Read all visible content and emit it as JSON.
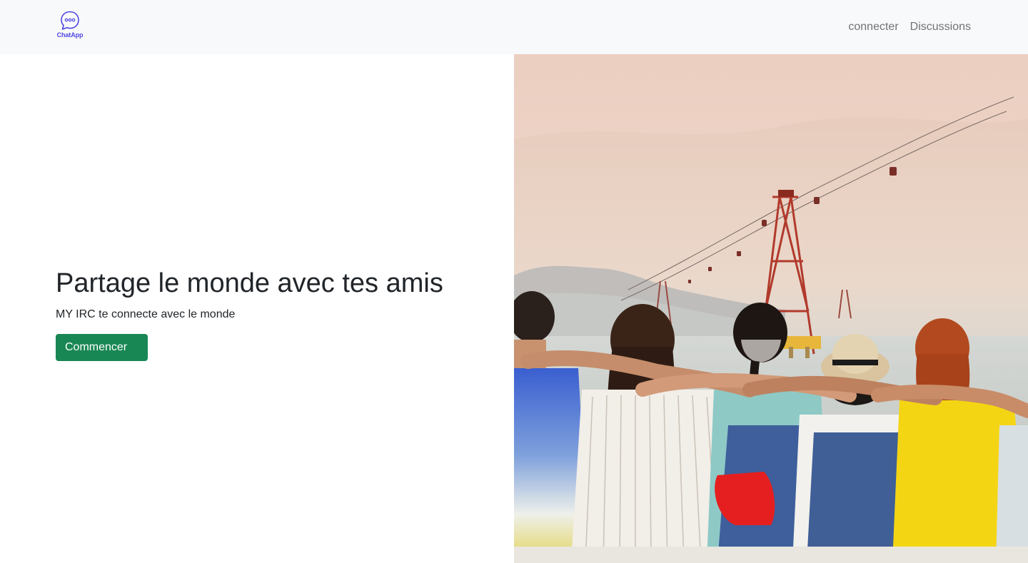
{
  "navbar": {
    "brand": {
      "icon": "chat-bubble-icon",
      "label": "ChatApp",
      "color": "#4f46e5"
    },
    "links": [
      "connecter",
      "Discussions"
    ]
  },
  "hero": {
    "title": "Partage le monde avec tes amis",
    "subtitle": "MY IRC te connecte avec le monde",
    "cta_label": "Commencer",
    "cta_color": "#198754",
    "image": {
      "subject": "friends-by-the-sea-photo"
    }
  }
}
